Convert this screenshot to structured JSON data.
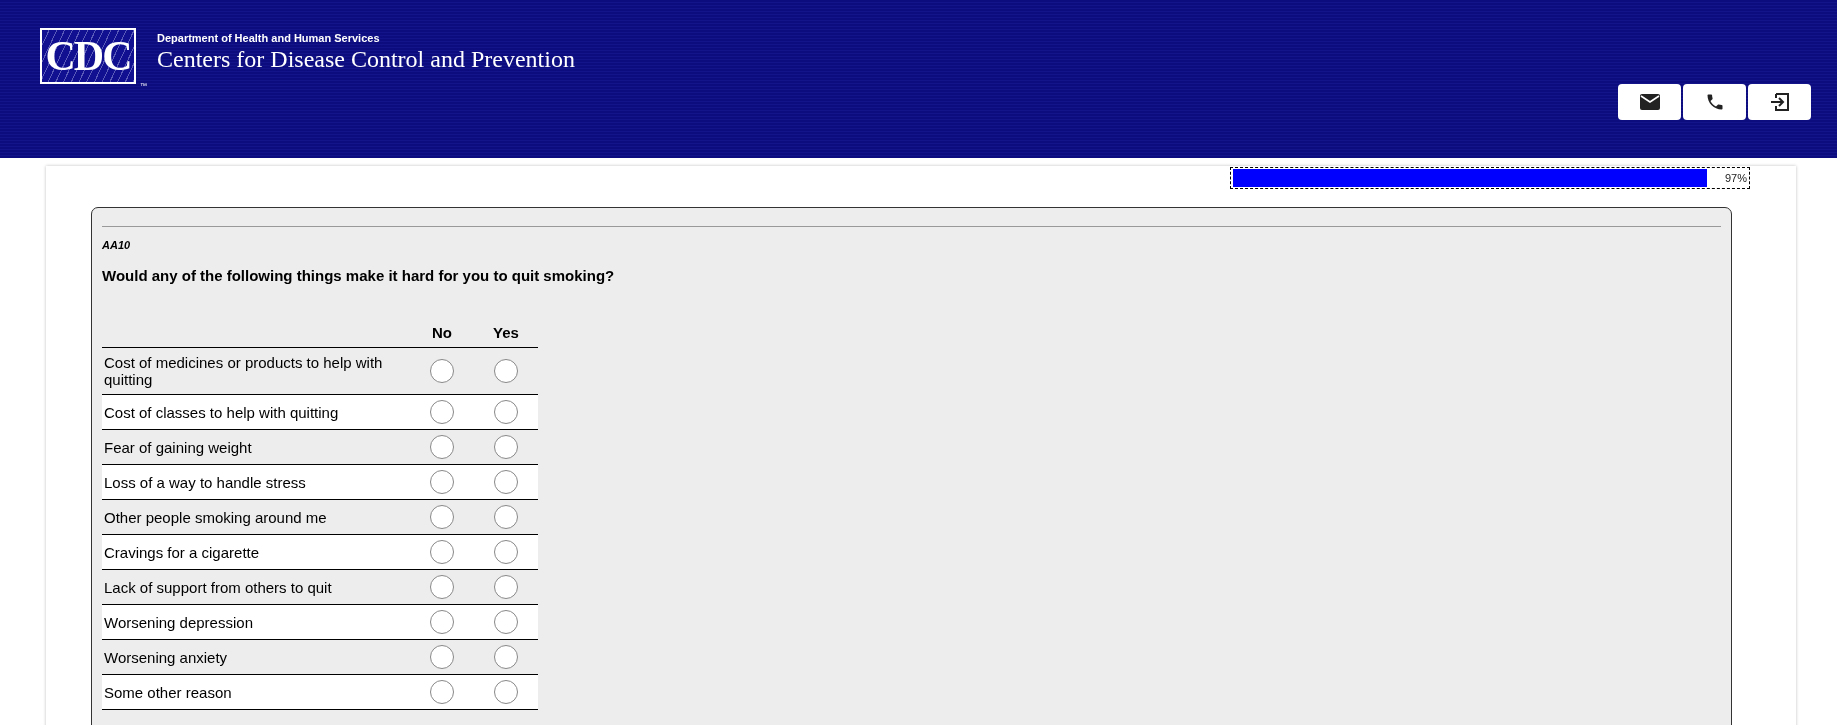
{
  "header": {
    "logo": {
      "text": "CDC",
      "mark": "™"
    },
    "department": "Department of Health and Human Services",
    "agency": "Centers for Disease Control and Prevention",
    "buttons": [
      {
        "kind": "email"
      },
      {
        "kind": "phone"
      },
      {
        "kind": "exit"
      }
    ]
  },
  "progress": {
    "level": 0.97,
    "label": "97%"
  },
  "question": {
    "code": "AA10",
    "text": "Would any of the following things make it hard for you to quit smoking?",
    "columns": [
      "No",
      "Yes"
    ],
    "rows": [
      {
        "label": "Cost of medicines or products to help with quitting",
        "options": [
          {
            "selected": false
          },
          {
            "selected": false
          }
        ]
      },
      {
        "label": "Cost of classes to help with quitting",
        "options": [
          {
            "selected": false
          },
          {
            "selected": false
          }
        ]
      },
      {
        "label": "Fear of gaining weight",
        "options": [
          {
            "selected": false
          },
          {
            "selected": false
          }
        ]
      },
      {
        "label": "Loss of a way to handle stress",
        "options": [
          {
            "selected": false
          },
          {
            "selected": false
          }
        ]
      },
      {
        "label": "Other people smoking around me",
        "options": [
          {
            "selected": false
          },
          {
            "selected": false
          }
        ]
      },
      {
        "label": "Cravings for a cigarette",
        "options": [
          {
            "selected": false
          },
          {
            "selected": false
          }
        ]
      },
      {
        "label": "Lack of support from others to quit",
        "options": [
          {
            "selected": false
          },
          {
            "selected": false
          }
        ]
      },
      {
        "label": "Worsening depression",
        "options": [
          {
            "selected": false
          },
          {
            "selected": false
          }
        ]
      },
      {
        "label": "Worsening anxiety",
        "options": [
          {
            "selected": false
          },
          {
            "selected": false
          }
        ]
      },
      {
        "label": "Some other reason",
        "options": [
          {
            "selected": false
          },
          {
            "selected": false
          }
        ]
      }
    ]
  }
}
